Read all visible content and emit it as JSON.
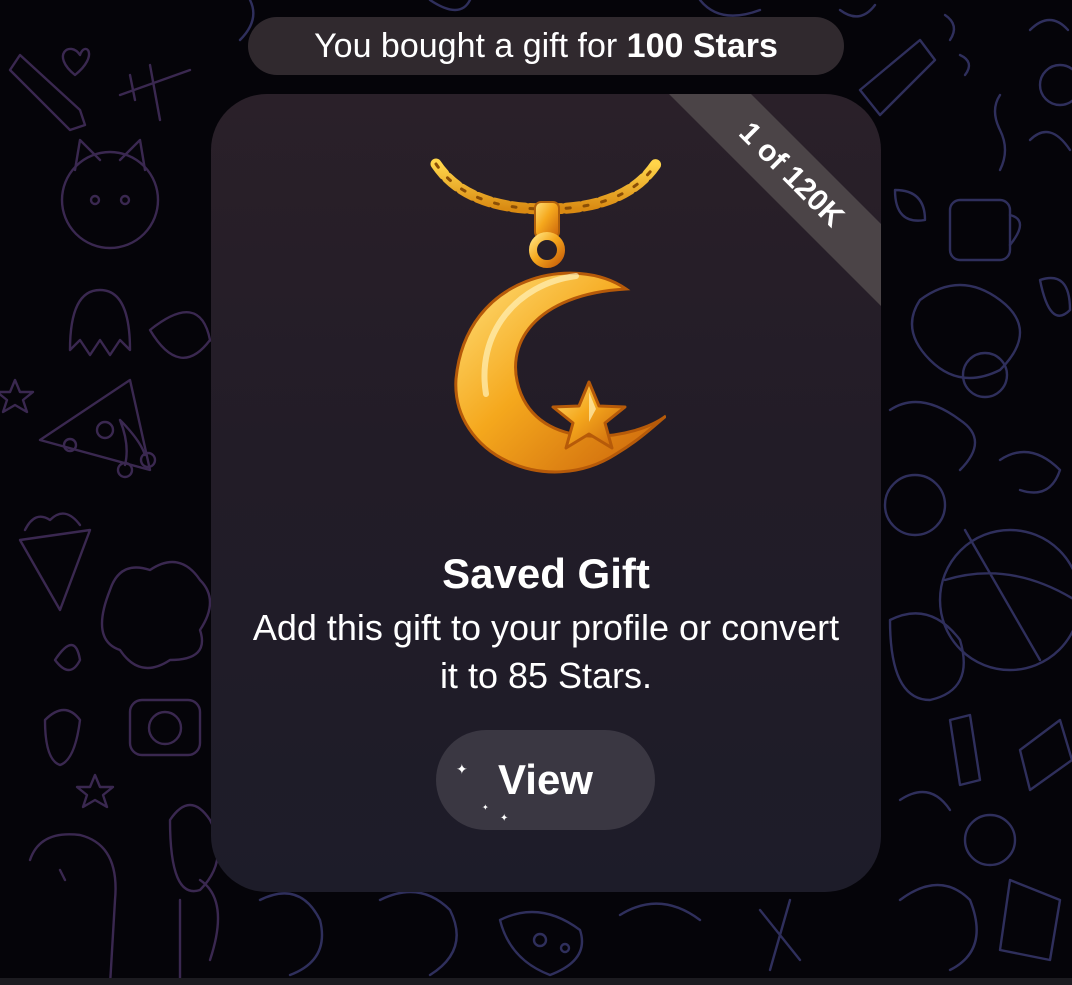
{
  "colors": {
    "background": "#050409",
    "doodle_purple": "#3d2a55",
    "doodle_blue": "#252a52",
    "pill_bg": "#342c32",
    "card_bg": "#241d28",
    "ribbon_bg": "#4b4447",
    "button_bg": "#3a3742",
    "gold": "#f3a21b",
    "text": "#ffffff"
  },
  "service_message": {
    "prefix": "You bought a gift for ",
    "amount": "100 Stars"
  },
  "gift_card": {
    "ribbon": "1 of 120K",
    "art_icon": "crescent-star-pendant-icon",
    "title": "Saved Gift",
    "subtitle": "Add this gift to your profile or convert it to 85 Stars.",
    "button_label": "View"
  }
}
